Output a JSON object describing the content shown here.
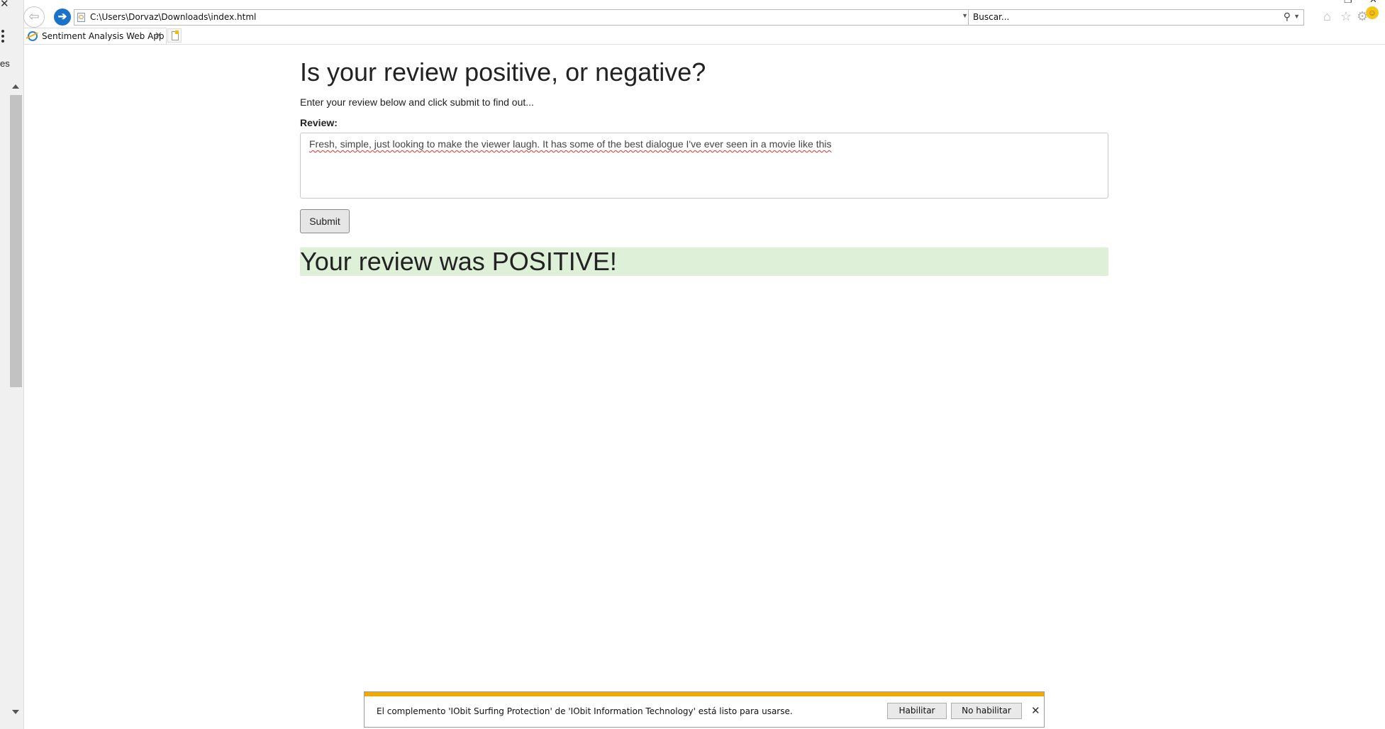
{
  "browser": {
    "address": "C:\\Users\\Dorvaz\\Downloads\\index.html",
    "search_placeholder": "Buscar...",
    "tab_title": "Sentiment Analysis Web App",
    "left_pane_label": "es"
  },
  "icons": {
    "back": "back-arrow-icon",
    "forward": "forward-arrow-icon",
    "home": "home-icon",
    "favorites": "star-icon",
    "settings": "gear-icon",
    "feedback": "smiley-icon"
  },
  "page": {
    "heading": "Is your review positive, or negative?",
    "intro": "Enter your review below and click submit to find out...",
    "review_label": "Review:",
    "review_text": "Fresh, simple, just looking to make the viewer laugh. It has some of the best dialogue I've ever seen in a movie like this",
    "submit_label": "Submit",
    "result_text": "Your review was POSITIVE!"
  },
  "notification": {
    "message": "El complemento 'IObit Surfing Protection' de 'IObit Information Technology' está listo para usarse.",
    "enable_label": "Habilitar",
    "disable_label": "No habilitar"
  },
  "colors": {
    "result_background": "#dff0d8",
    "notification_accent": "#f2a900",
    "forward_button": "#1a73c8"
  }
}
